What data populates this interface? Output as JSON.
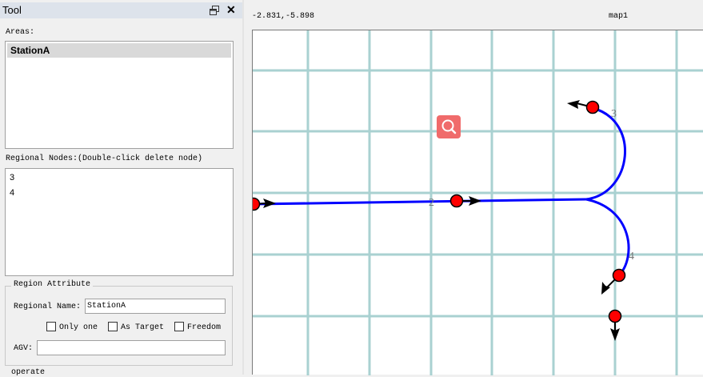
{
  "dock": {
    "title": "Tool",
    "float_icon": "restore-icon",
    "close_label": "✕"
  },
  "areas": {
    "label": "Areas:",
    "items": [
      "StationA"
    ],
    "selected": "StationA"
  },
  "nodes": {
    "label": "Regional Nodes:(Double-click delete node)",
    "items": [
      "3",
      "4"
    ]
  },
  "region_attribute": {
    "legend": "Region Attribute",
    "name_label": "Regional Name:",
    "name_value": "StationA",
    "only_one_label": "Only one",
    "only_one_checked": false,
    "as_target_label": "As Target",
    "as_target_checked": false,
    "freedom_label": "Freedom",
    "freedom_checked": false,
    "agv_label": "AGV:",
    "agv_value": ""
  },
  "operate": {
    "legend": "operate"
  },
  "map": {
    "coords": "-2.831,-5.898",
    "title": "map1",
    "grid_color": "#a9d1d1",
    "path_color": "#0000ff",
    "node_color": "#ff0000",
    "node_labels": [
      "2",
      "3",
      "4"
    ],
    "zoom_icon": "search-icon",
    "zoom_color": "#f06b6b"
  }
}
